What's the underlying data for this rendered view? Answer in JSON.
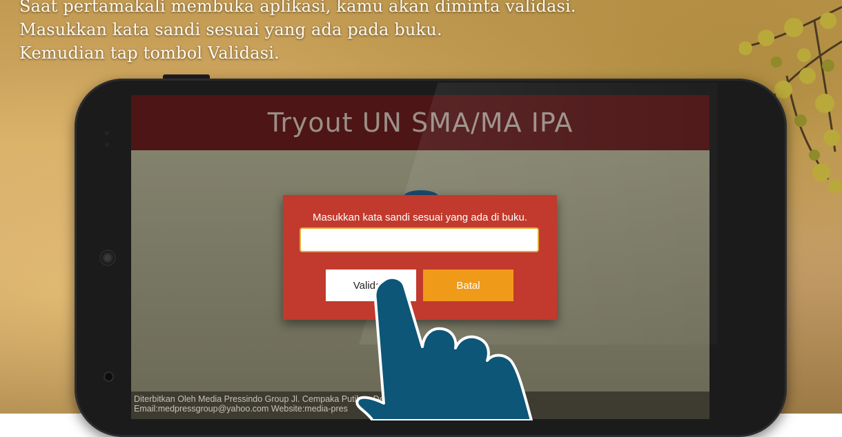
{
  "instructions": {
    "line1": "Saat pertamakali membuka aplikasi, kamu akan diminta validasi.",
    "line2": "Masukkan kata sandi sesuai yang ada pada buku.",
    "line3": "Kemudian tap tombol Validasi."
  },
  "app": {
    "title": "Tryout UN SMA/MA IPA"
  },
  "dialog": {
    "prompt": "Masukkan kata sandi sesuai yang ada di buku.",
    "password_value": "",
    "validate_label": "Validasi",
    "cancel_label": "Batal"
  },
  "footer": {
    "line1": "Diterbitkan Oleh Media Pressindo Group Jl. Cempaka Putih ... Den",
    "line2": "Email:medpressgroup@yahoo.com Website:media-pres"
  },
  "icons": {
    "hand": "pointing-hand-icon",
    "camera": "front-camera-icon",
    "speaker": "speaker-icon"
  },
  "colors": {
    "appbar": "#4d1516",
    "dialog": "#c13a2d",
    "cancel_button": "#f09a1a",
    "hand": "#0d5677"
  }
}
